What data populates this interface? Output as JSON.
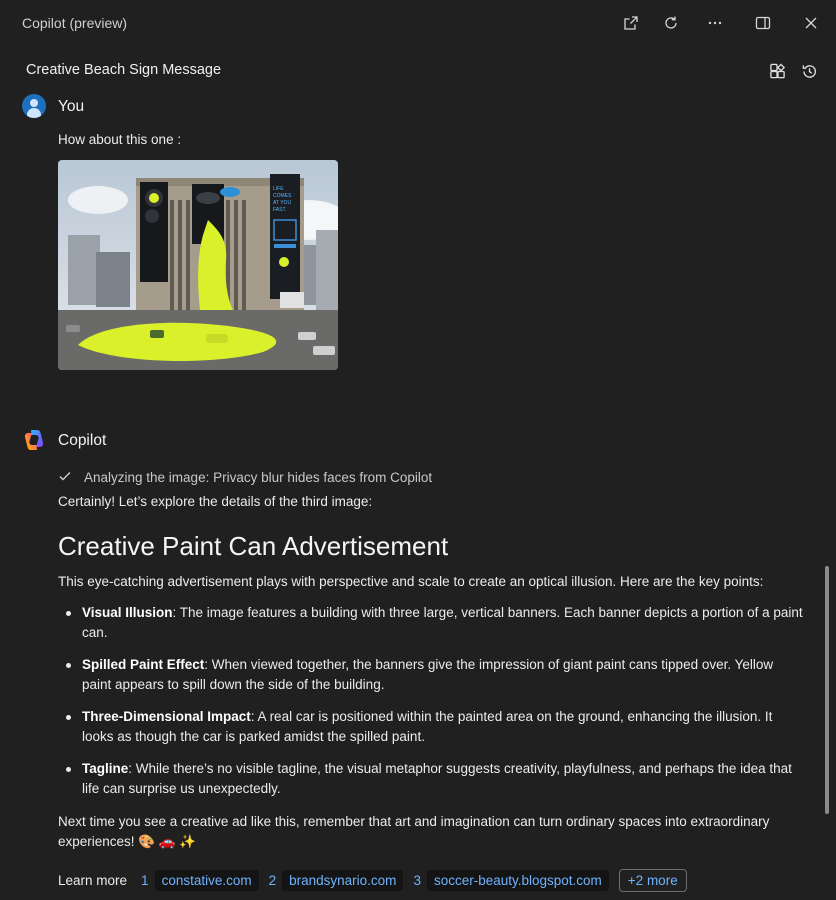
{
  "window": {
    "title": "Copilot (preview)",
    "buttons": [
      "open-in-new-window-icon",
      "refresh-icon",
      "more-icon",
      "side-panel-icon",
      "close-icon"
    ]
  },
  "conversation": {
    "title": "Creative Beach Sign Message"
  },
  "user_message": {
    "sender": "You",
    "text": "How about this one :",
    "image_text": [
      "LIFE",
      "COMES",
      "AT YOU",
      "FAST."
    ]
  },
  "copilot_message": {
    "sender": "Copilot",
    "analysis": "Analyzing the image: Privacy blur hides faces from Copilot",
    "intro": "Certainly! Let’s explore the details of the third image:",
    "heading": "Creative Paint Can Advertisement",
    "lead": "This eye-catching advertisement plays with perspective and scale to create an optical illusion. Here are the key points:",
    "points": [
      {
        "title": "Visual Illusion",
        "text": ": The image features a building with three large, vertical banners. Each banner depicts a portion of a paint can."
      },
      {
        "title": "Spilled Paint Effect",
        "text": ": When viewed together, the banners give the impression of giant paint cans tipped over. Yellow paint appears to spill down the side of the building."
      },
      {
        "title": "Three-Dimensional Impact",
        "text": ": A real car is positioned within the painted area on the ground, enhancing the illusion. It looks as though the car is parked amidst the spilled paint."
      },
      {
        "title": "Tagline",
        "text": ": While there’s no visible tagline, the visual metaphor suggests creativity, playfulness, and perhaps the idea that life can surprise us unexpectedly."
      }
    ],
    "closing": "Next time you see a creative ad like this, remember that art and imagination can turn ordinary spaces into extraordinary experiences! 🎨 🚗 ✨",
    "learn_more_label": "Learn more",
    "sources": [
      {
        "num": "1",
        "label": "constative.com"
      },
      {
        "num": "2",
        "label": "brandsynario.com"
      },
      {
        "num": "3",
        "label": "soccer-beauty.blogspot.com"
      }
    ],
    "more_label": "+2 more"
  },
  "colors": {
    "background": "#202020",
    "link": "#6fb3ff",
    "paint": "#d9f02a"
  }
}
